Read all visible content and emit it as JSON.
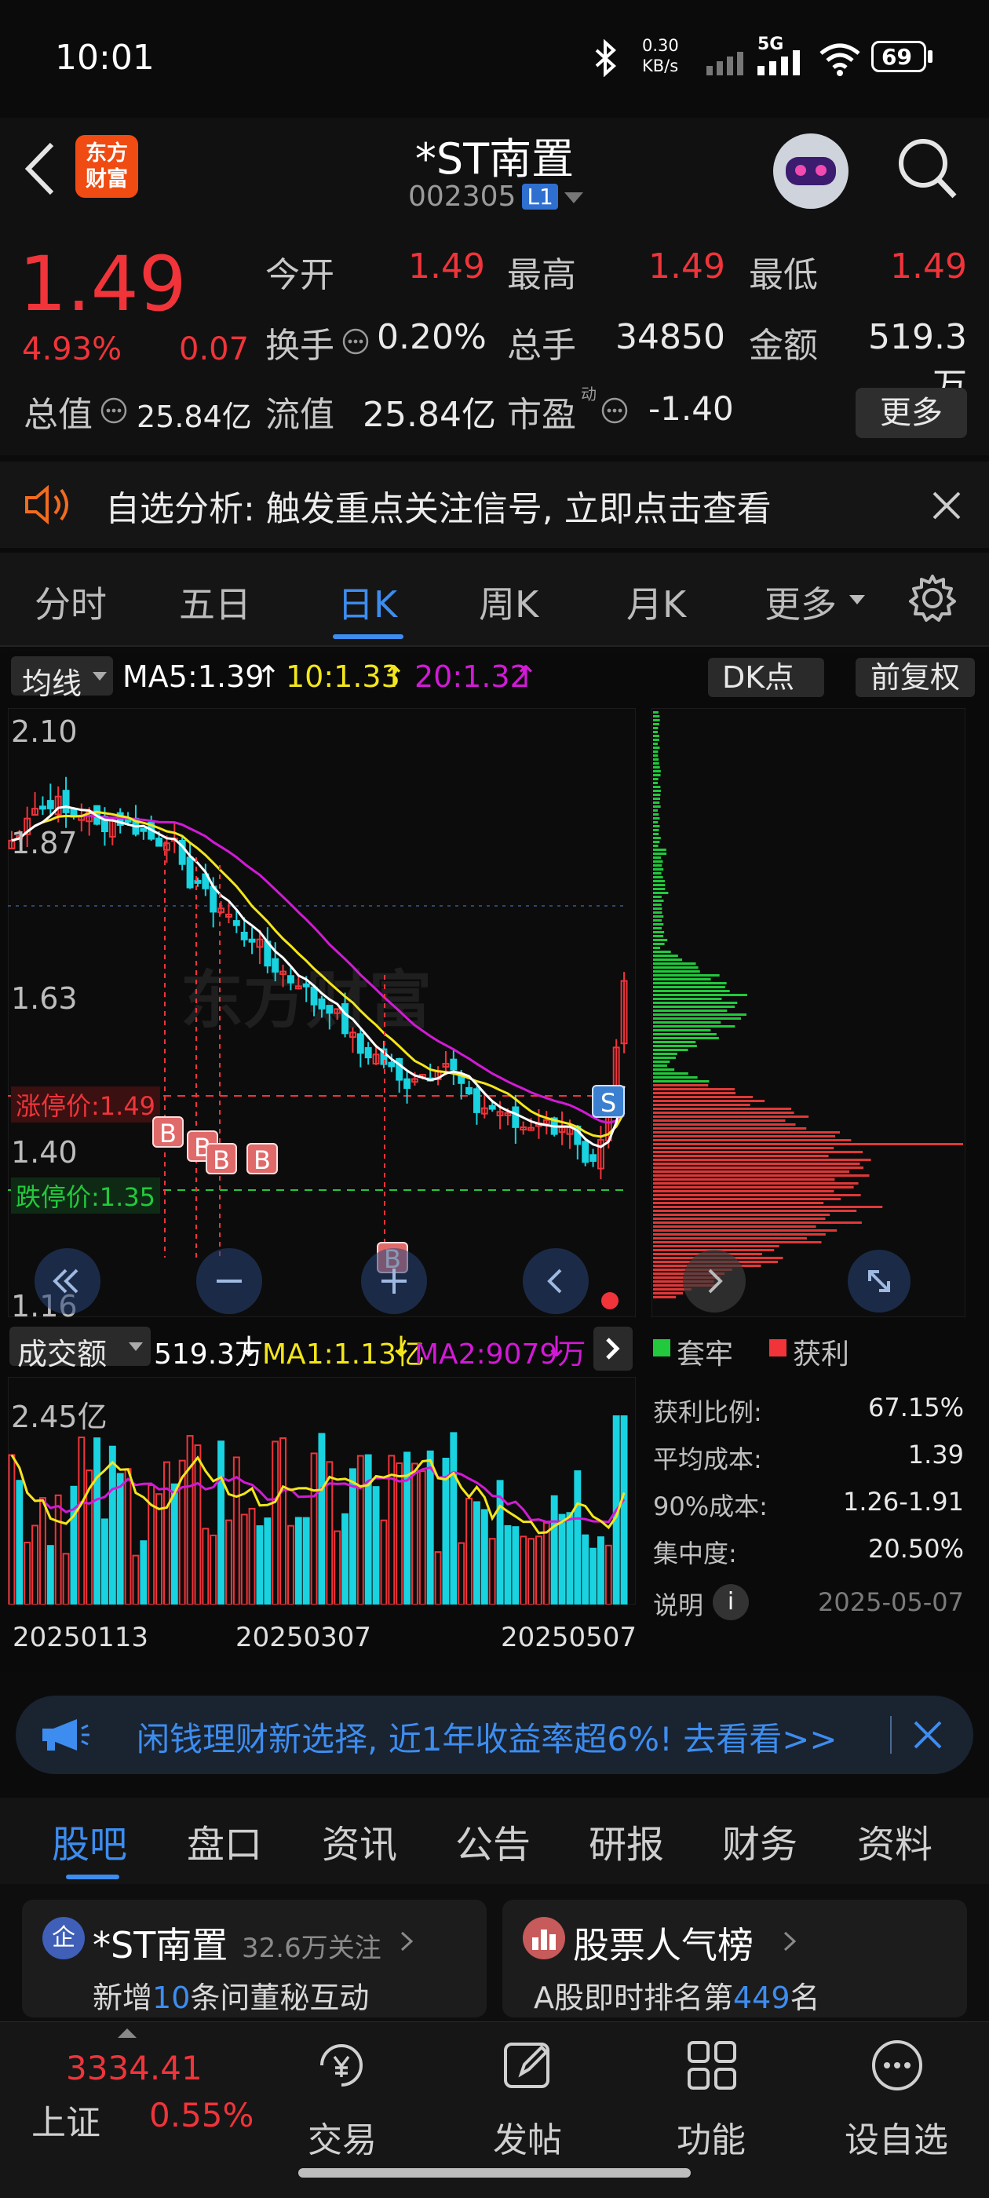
{
  "status_bar": {
    "time": "10:01",
    "net_speed_value": "0.30",
    "net_speed_unit": "KB/s",
    "network": "5G",
    "battery": "69"
  },
  "header": {
    "logo_text": "东方\n财富",
    "stock_name": "*ST南置",
    "stock_code": "002305",
    "level_badge": "L1"
  },
  "quote": {
    "price": "1.49",
    "change_pct": "4.93%",
    "change_amt": "0.07",
    "open_label": "今开",
    "open_value": "1.49",
    "high_label": "最高",
    "high_value": "1.49",
    "low_label": "最低",
    "low_value": "1.49",
    "turnover_label": "换手",
    "turnover_value": "0.20%",
    "volume_label": "总手",
    "volume_value": "34850",
    "amount_label": "金额",
    "amount_value": "519.3万",
    "mktcap_label": "总值",
    "mktcap_value": "25.84亿",
    "float_label": "流值",
    "float_value": "25.84亿",
    "pe_label": "市盈",
    "pe_superscript": "动",
    "pe_value": "-1.40",
    "more_button": "更多"
  },
  "banner": {
    "text": "自选分析: 触发重点关注信号, 立即点击查看"
  },
  "kline_tabs": [
    "分时",
    "五日",
    "日K",
    "周K",
    "月K",
    "更多"
  ],
  "kline_active_tab": "日K",
  "chart": {
    "indicator_select": "均线",
    "ma5_label": "MA5:1.39",
    "ma10_label": "10:1.33",
    "ma20_label": "20:1.32",
    "dk_button": "DK点",
    "restore_button": "前复权",
    "price_ticks": [
      "2.10",
      "1.87",
      "1.63",
      "1.40",
      "1.16"
    ],
    "limit_up_label": "涨停价:1.49",
    "limit_down_label": "跌停价:1.35",
    "signal_b": "B",
    "signal_s": "S",
    "volume_select": "成交额",
    "vol_label": "519.3万",
    "vol_ma1": "MA1:1.13亿",
    "vol_ma2": "MA2:9079万",
    "vol_tick": "2.45亿",
    "dates": [
      "20250113",
      "20250307",
      "20250507"
    ],
    "watermark": "东方财富"
  },
  "chip": {
    "legend_trapped": "套牢",
    "legend_profit": "获利",
    "rows": [
      {
        "label": "获利比例:",
        "value": "67.15%"
      },
      {
        "label": "平均成本:",
        "value": "1.39"
      },
      {
        "label": "90%成本:",
        "value": "1.26-1.91"
      },
      {
        "label": "集中度:",
        "value": "20.50%"
      }
    ],
    "explain_label": "说明",
    "date": "2025-05-07"
  },
  "ad_bar": {
    "text": "闲钱理财新选择, 近1年收益率超6%! 去看看>>"
  },
  "bottom_tabs": [
    "股吧",
    "盘口",
    "资讯",
    "公告",
    "研报",
    "财务",
    "资料"
  ],
  "cards": {
    "left_title": "*ST南置",
    "left_follow": "32.6万关注",
    "left_desc_a": "新增",
    "left_desc_num": "10",
    "left_desc_b": "条问董秘互动",
    "right_title": "股票人气榜",
    "right_desc_a": "A股即时排名第",
    "right_desc_num": "449",
    "right_desc_b": "名"
  },
  "bottom_nav": {
    "index_value": "3334.41",
    "index_name": "上证",
    "index_change": "0.55%",
    "items": [
      "交易",
      "发帖",
      "功能",
      "设自选"
    ]
  },
  "colors": {
    "up": "#f0343a",
    "down": "#19d3e0",
    "ma5": "#ffffff",
    "ma10": "#f3e61b",
    "ma20": "#d21ad6",
    "accent": "#3d8df0"
  }
}
